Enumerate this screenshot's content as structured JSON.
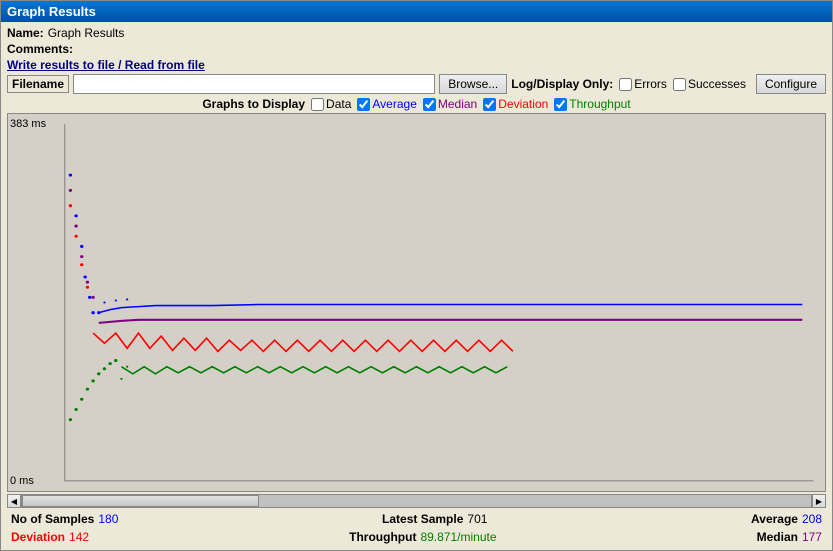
{
  "window": {
    "title": "Graph Results"
  },
  "header": {
    "name_label": "Name:",
    "name_value": "Graph Results",
    "comments_label": "Comments:",
    "write_label": "Write results to file / Read from file",
    "filename_label": "Filename",
    "filename_value": "",
    "filename_placeholder": "",
    "browse_label": "Browse...",
    "log_label": "Log/Display Only:",
    "errors_label": "Errors",
    "successes_label": "Successes",
    "configure_label": "Configure"
  },
  "graphs": {
    "label": "Graphs to Display",
    "data_label": "Data",
    "average_label": "Average",
    "median_label": "Median",
    "deviation_label": "Deviation",
    "throughput_label": "Throughput"
  },
  "chart": {
    "y_top": "383 ms",
    "y_bottom": "0 ms"
  },
  "stats": {
    "samples_label": "No of Samples",
    "samples_value": "180",
    "latest_label": "Latest Sample",
    "latest_value": "701",
    "average_label": "Average",
    "average_value": "208",
    "deviation_label": "Deviation",
    "deviation_value": "142",
    "throughput_label": "Throughput",
    "throughput_value": "89.871/minute",
    "median_label": "Median",
    "median_value": "177"
  },
  "colors": {
    "average": "#0000ff",
    "median": "#800080",
    "deviation": "#ff0000",
    "throughput": "#008000"
  }
}
